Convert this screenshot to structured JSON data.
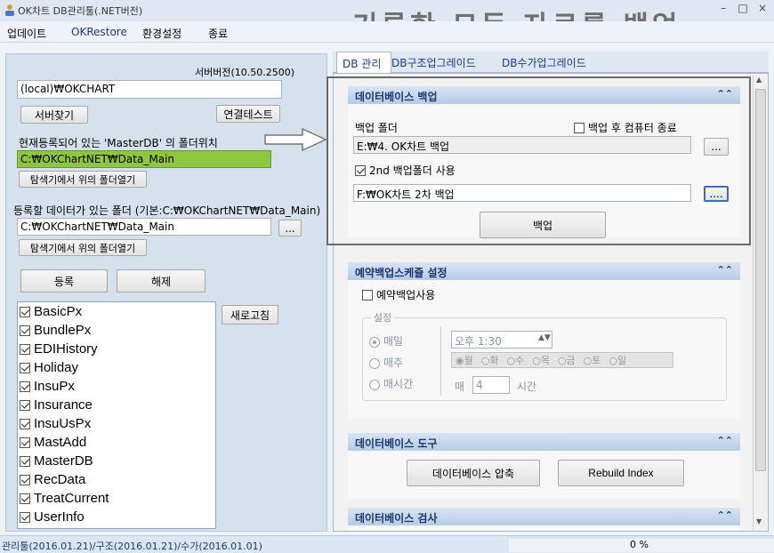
{
  "window": {
    "title": "OK차트 DB관리툴(.NET버전)",
    "controls": [
      "–",
      "□",
      "×"
    ]
  },
  "banner": "기록한 모든 자료를 백업",
  "menu": [
    "업데이트",
    "OKRestore",
    "환경설정",
    "종료"
  ],
  "left": {
    "server_version": "서버버전(10.50.2500)",
    "server_value": "(local)₩OKCHART",
    "find_server": "서버찾기",
    "conn_test": "연결테스트",
    "masterdb_label": "현재등록되어 있는 'MasterDB' 의 폴더위치",
    "masterdb_path": "C:₩OKChartNET₩Data_Main",
    "open_explorer_1": "탐색기에서 위의 폴더열기",
    "reg_folder_label": "등록할 데이터가 있는 폴더 (기본:C:₩OKChartNET₩Data_Main)",
    "reg_folder_path": "C:₩OKChartNET₩Data_Main",
    "browse": "...",
    "open_explorer_2": "탐색기에서 위의 폴더열기",
    "register": "등록",
    "unregister": "해제",
    "refresh": "새로고침",
    "databases": [
      "BasicPx",
      "BundlePx",
      "EDIHistory",
      "Holiday",
      "InsuPx",
      "Insurance",
      "InsuUsPx",
      "MastAdd",
      "MasterDB",
      "RecData",
      "TreatCurrent",
      "UserInfo"
    ]
  },
  "tabs": [
    "DB 관리",
    "DB구조업그레이드",
    "DB수가업그레이드"
  ],
  "backup": {
    "header": "데이터베이스 백업",
    "folder_label": "백업 폴더",
    "shutdown_label": "백업 후 컴퓨터 종료",
    "folder_value": "E:₩4. OK차트 백업",
    "second_label": "2nd 백업폴더 사용",
    "second_value": "F:₩OK차트 2차 백업",
    "browse": "...",
    "browse2": "....",
    "button": "백업"
  },
  "schedule": {
    "header": "예약백업스케쥴 설정",
    "use_label": "예약백업사용",
    "settings_label": "설정",
    "daily": "매일",
    "weekly": "매주",
    "hourly": "매시간",
    "time_value": "오후  1:30",
    "days": [
      "월",
      "화",
      "수",
      "목",
      "금",
      "토",
      "일"
    ],
    "every_label": "매",
    "hour_value": "4",
    "hour_unit": "시간"
  },
  "tools": {
    "header": "데이터베이스 도구",
    "compress": "데이터베이스 압축",
    "rebuild": "Rebuild Index"
  },
  "inspect": {
    "header": "데이터베이스 검사"
  },
  "status": {
    "version_text": "관리툴(2016.01.21)/구조(2016.01.21)/수가(2016.01.01)",
    "percent": "0 %"
  },
  "colors": {
    "highlight_path_bg": "#8fc640",
    "header_text": "#17386e"
  }
}
